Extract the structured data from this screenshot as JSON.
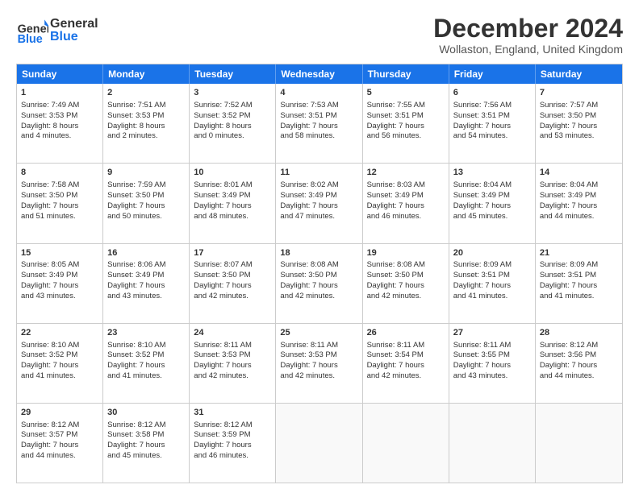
{
  "header": {
    "logo_general": "General",
    "logo_blue": "Blue",
    "month_title": "December 2024",
    "location": "Wollaston, England, United Kingdom"
  },
  "days_of_week": [
    "Sunday",
    "Monday",
    "Tuesday",
    "Wednesday",
    "Thursday",
    "Friday",
    "Saturday"
  ],
  "weeks": [
    [
      {
        "day": "1",
        "lines": [
          "Sunrise: 7:49 AM",
          "Sunset: 3:53 PM",
          "Daylight: 8 hours",
          "and 4 minutes."
        ]
      },
      {
        "day": "2",
        "lines": [
          "Sunrise: 7:51 AM",
          "Sunset: 3:53 PM",
          "Daylight: 8 hours",
          "and 2 minutes."
        ]
      },
      {
        "day": "3",
        "lines": [
          "Sunrise: 7:52 AM",
          "Sunset: 3:52 PM",
          "Daylight: 8 hours",
          "and 0 minutes."
        ]
      },
      {
        "day": "4",
        "lines": [
          "Sunrise: 7:53 AM",
          "Sunset: 3:51 PM",
          "Daylight: 7 hours",
          "and 58 minutes."
        ]
      },
      {
        "day": "5",
        "lines": [
          "Sunrise: 7:55 AM",
          "Sunset: 3:51 PM",
          "Daylight: 7 hours",
          "and 56 minutes."
        ]
      },
      {
        "day": "6",
        "lines": [
          "Sunrise: 7:56 AM",
          "Sunset: 3:51 PM",
          "Daylight: 7 hours",
          "and 54 minutes."
        ]
      },
      {
        "day": "7",
        "lines": [
          "Sunrise: 7:57 AM",
          "Sunset: 3:50 PM",
          "Daylight: 7 hours",
          "and 53 minutes."
        ]
      }
    ],
    [
      {
        "day": "8",
        "lines": [
          "Sunrise: 7:58 AM",
          "Sunset: 3:50 PM",
          "Daylight: 7 hours",
          "and 51 minutes."
        ]
      },
      {
        "day": "9",
        "lines": [
          "Sunrise: 7:59 AM",
          "Sunset: 3:50 PM",
          "Daylight: 7 hours",
          "and 50 minutes."
        ]
      },
      {
        "day": "10",
        "lines": [
          "Sunrise: 8:01 AM",
          "Sunset: 3:49 PM",
          "Daylight: 7 hours",
          "and 48 minutes."
        ]
      },
      {
        "day": "11",
        "lines": [
          "Sunrise: 8:02 AM",
          "Sunset: 3:49 PM",
          "Daylight: 7 hours",
          "and 47 minutes."
        ]
      },
      {
        "day": "12",
        "lines": [
          "Sunrise: 8:03 AM",
          "Sunset: 3:49 PM",
          "Daylight: 7 hours",
          "and 46 minutes."
        ]
      },
      {
        "day": "13",
        "lines": [
          "Sunrise: 8:04 AM",
          "Sunset: 3:49 PM",
          "Daylight: 7 hours",
          "and 45 minutes."
        ]
      },
      {
        "day": "14",
        "lines": [
          "Sunrise: 8:04 AM",
          "Sunset: 3:49 PM",
          "Daylight: 7 hours",
          "and 44 minutes."
        ]
      }
    ],
    [
      {
        "day": "15",
        "lines": [
          "Sunrise: 8:05 AM",
          "Sunset: 3:49 PM",
          "Daylight: 7 hours",
          "and 43 minutes."
        ]
      },
      {
        "day": "16",
        "lines": [
          "Sunrise: 8:06 AM",
          "Sunset: 3:49 PM",
          "Daylight: 7 hours",
          "and 43 minutes."
        ]
      },
      {
        "day": "17",
        "lines": [
          "Sunrise: 8:07 AM",
          "Sunset: 3:50 PM",
          "Daylight: 7 hours",
          "and 42 minutes."
        ]
      },
      {
        "day": "18",
        "lines": [
          "Sunrise: 8:08 AM",
          "Sunset: 3:50 PM",
          "Daylight: 7 hours",
          "and 42 minutes."
        ]
      },
      {
        "day": "19",
        "lines": [
          "Sunrise: 8:08 AM",
          "Sunset: 3:50 PM",
          "Daylight: 7 hours",
          "and 42 minutes."
        ]
      },
      {
        "day": "20",
        "lines": [
          "Sunrise: 8:09 AM",
          "Sunset: 3:51 PM",
          "Daylight: 7 hours",
          "and 41 minutes."
        ]
      },
      {
        "day": "21",
        "lines": [
          "Sunrise: 8:09 AM",
          "Sunset: 3:51 PM",
          "Daylight: 7 hours",
          "and 41 minutes."
        ]
      }
    ],
    [
      {
        "day": "22",
        "lines": [
          "Sunrise: 8:10 AM",
          "Sunset: 3:52 PM",
          "Daylight: 7 hours",
          "and 41 minutes."
        ]
      },
      {
        "day": "23",
        "lines": [
          "Sunrise: 8:10 AM",
          "Sunset: 3:52 PM",
          "Daylight: 7 hours",
          "and 41 minutes."
        ]
      },
      {
        "day": "24",
        "lines": [
          "Sunrise: 8:11 AM",
          "Sunset: 3:53 PM",
          "Daylight: 7 hours",
          "and 42 minutes."
        ]
      },
      {
        "day": "25",
        "lines": [
          "Sunrise: 8:11 AM",
          "Sunset: 3:53 PM",
          "Daylight: 7 hours",
          "and 42 minutes."
        ]
      },
      {
        "day": "26",
        "lines": [
          "Sunrise: 8:11 AM",
          "Sunset: 3:54 PM",
          "Daylight: 7 hours",
          "and 42 minutes."
        ]
      },
      {
        "day": "27",
        "lines": [
          "Sunrise: 8:11 AM",
          "Sunset: 3:55 PM",
          "Daylight: 7 hours",
          "and 43 minutes."
        ]
      },
      {
        "day": "28",
        "lines": [
          "Sunrise: 8:12 AM",
          "Sunset: 3:56 PM",
          "Daylight: 7 hours",
          "and 44 minutes."
        ]
      }
    ],
    [
      {
        "day": "29",
        "lines": [
          "Sunrise: 8:12 AM",
          "Sunset: 3:57 PM",
          "Daylight: 7 hours",
          "and 44 minutes."
        ]
      },
      {
        "day": "30",
        "lines": [
          "Sunrise: 8:12 AM",
          "Sunset: 3:58 PM",
          "Daylight: 7 hours",
          "and 45 minutes."
        ]
      },
      {
        "day": "31",
        "lines": [
          "Sunrise: 8:12 AM",
          "Sunset: 3:59 PM",
          "Daylight: 7 hours",
          "and 46 minutes."
        ]
      },
      {
        "day": "",
        "lines": []
      },
      {
        "day": "",
        "lines": []
      },
      {
        "day": "",
        "lines": []
      },
      {
        "day": "",
        "lines": []
      }
    ]
  ]
}
